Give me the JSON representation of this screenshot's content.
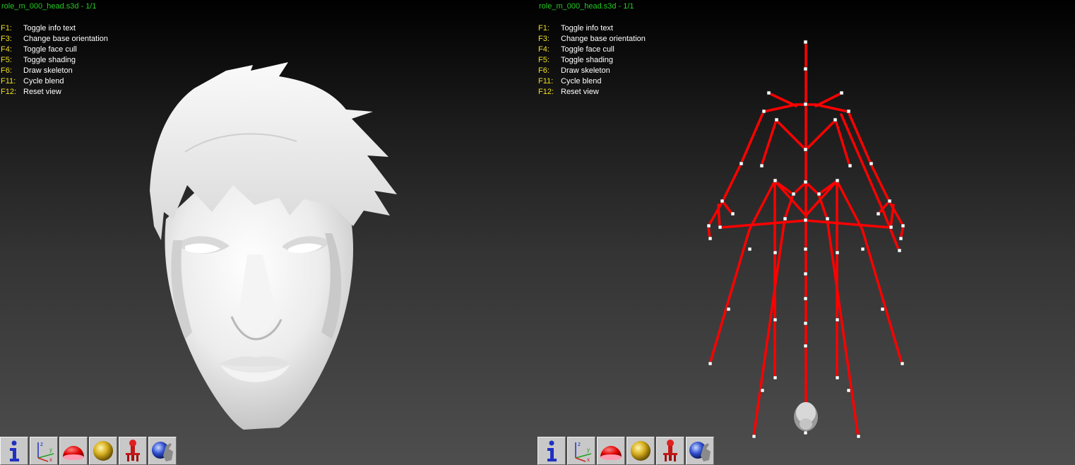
{
  "left_view": {
    "title": "role_m_000_head.s3d - 1/1",
    "help": [
      {
        "key": "F1:",
        "text": "Toggle info text"
      },
      {
        "key": "F3:",
        "text": "Change base orientation"
      },
      {
        "key": "F4:",
        "text": "Toggle face cull"
      },
      {
        "key": "F5:",
        "text": "Toggle shading"
      },
      {
        "key": "F6:",
        "text": "Draw skeleton"
      },
      {
        "key": "F11:",
        "text": "Cycle blend"
      },
      {
        "key": "F12:",
        "text": "Reset view"
      }
    ]
  },
  "right_view": {
    "title": "role_m_000_head.s3d - 1/1",
    "help": [
      {
        "key": "F1:",
        "text": "Toggle info text"
      },
      {
        "key": "F3:",
        "text": "Change base orientation"
      },
      {
        "key": "F4:",
        "text": "Toggle face cull"
      },
      {
        "key": "F5:",
        "text": "Toggle shading"
      },
      {
        "key": "F6:",
        "text": "Draw skeleton"
      },
      {
        "key": "F11:",
        "text": "Cycle blend"
      },
      {
        "key": "F12:",
        "text": "Reset view"
      }
    ]
  },
  "toolbar": {
    "buttons": [
      {
        "icon": "info-icon"
      },
      {
        "icon": "axes-icon"
      },
      {
        "icon": "red-dome-icon"
      },
      {
        "icon": "gold-sphere-icon"
      },
      {
        "icon": "robot-skeleton-icon"
      },
      {
        "icon": "blue-sphere-hand-icon"
      }
    ]
  },
  "colors": {
    "title_text": "#22cc22",
    "help_key": "#f0e020",
    "help_text": "#ffffff",
    "skeleton_bone": "#ff0000",
    "skeleton_joint": "#ffffff",
    "toolbar_button": "#c8c8c8"
  }
}
